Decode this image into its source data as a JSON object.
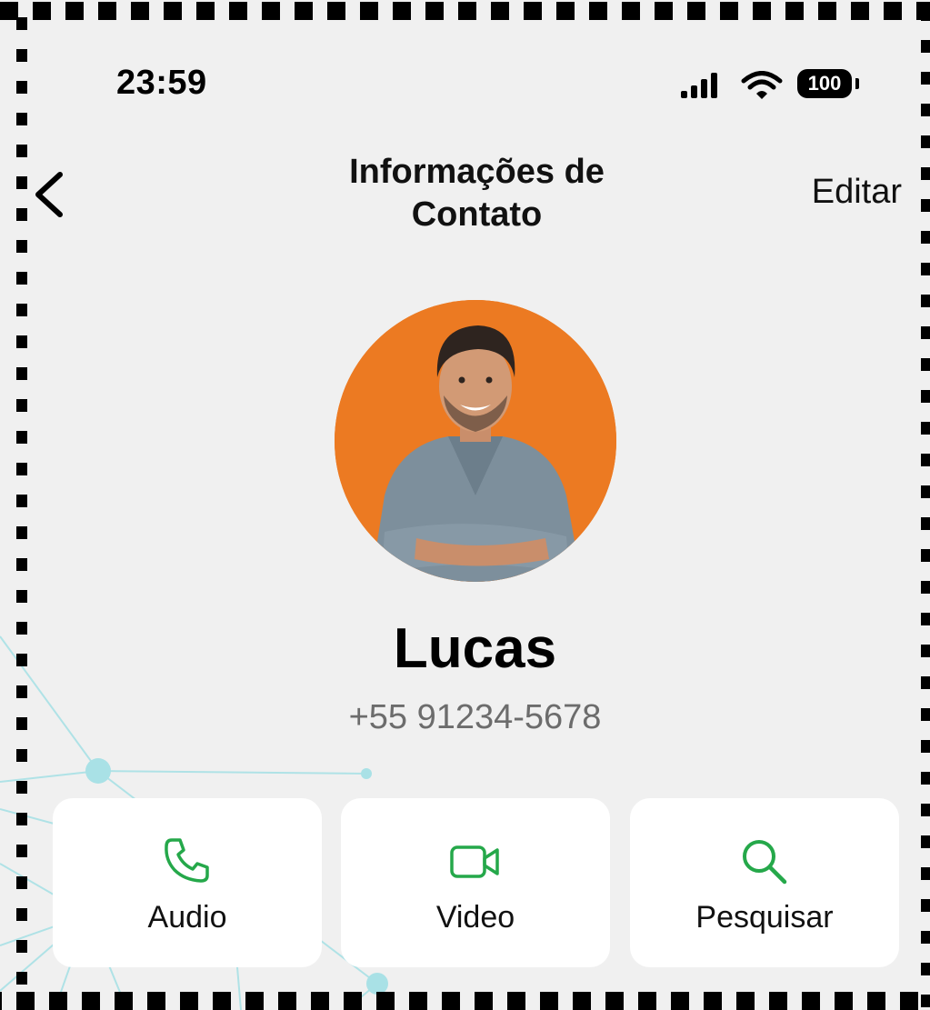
{
  "status_bar": {
    "time": "23:59",
    "battery": "100",
    "icons": [
      "cellular-signal-icon",
      "wifi-icon",
      "battery-icon"
    ]
  },
  "nav": {
    "back_icon": "chevron-left-icon",
    "title_line1": "Informações de",
    "title_line2": "Contato",
    "edit_label": "Editar"
  },
  "contact": {
    "name": "Lucas",
    "phone": "+55 91234-5678",
    "avatar_background": "#ec7a22"
  },
  "actions": [
    {
      "label": "Audio",
      "icon": "phone-icon"
    },
    {
      "label": "Video",
      "icon": "video-camera-icon"
    },
    {
      "label": "Pesquisar",
      "icon": "search-icon"
    }
  ],
  "colors": {
    "accent": "#25a84a",
    "background": "#f0f0f0",
    "card": "#ffffff",
    "secondary_text": "#6c6c6c"
  }
}
